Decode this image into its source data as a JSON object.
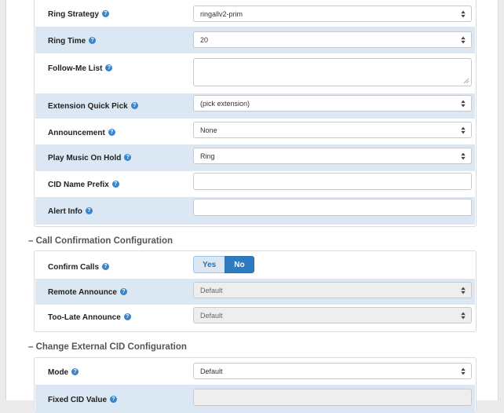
{
  "followme": {
    "rows": [
      {
        "label": "Ring Strategy",
        "value": "ringallv2-prim",
        "type": "select"
      },
      {
        "label": "Ring Time",
        "value": "20",
        "type": "select"
      },
      {
        "label": "Follow-Me List",
        "value": "",
        "type": "textarea"
      },
      {
        "label": "Extension Quick Pick",
        "value": "(pick extension)",
        "type": "select"
      },
      {
        "label": "Announcement",
        "value": "None",
        "type": "select"
      },
      {
        "label": "Play Music On Hold",
        "value": "Ring",
        "type": "select"
      },
      {
        "label": "CID Name Prefix",
        "value": "",
        "type": "input"
      },
      {
        "label": "Alert Info",
        "value": "",
        "type": "input"
      }
    ]
  },
  "call_confirmation": {
    "title": "– Call Confirmation Configuration",
    "confirm_calls": {
      "label": "Confirm Calls",
      "yes": "Yes",
      "no": "No",
      "selected": "No"
    },
    "remote_announce": {
      "label": "Remote Announce",
      "value": "Default"
    },
    "too_late_announce": {
      "label": "Too-Late Announce",
      "value": "Default"
    }
  },
  "external_cid": {
    "title": "– Change External CID Configuration",
    "mode": {
      "label": "Mode",
      "value": "Default"
    },
    "fixed_cid": {
      "label": "Fixed CID Value",
      "value": ""
    }
  },
  "help_icon": "question-circle-icon",
  "colors": {
    "accent": "#2f7bc0",
    "shade": "#dbe7f3"
  }
}
